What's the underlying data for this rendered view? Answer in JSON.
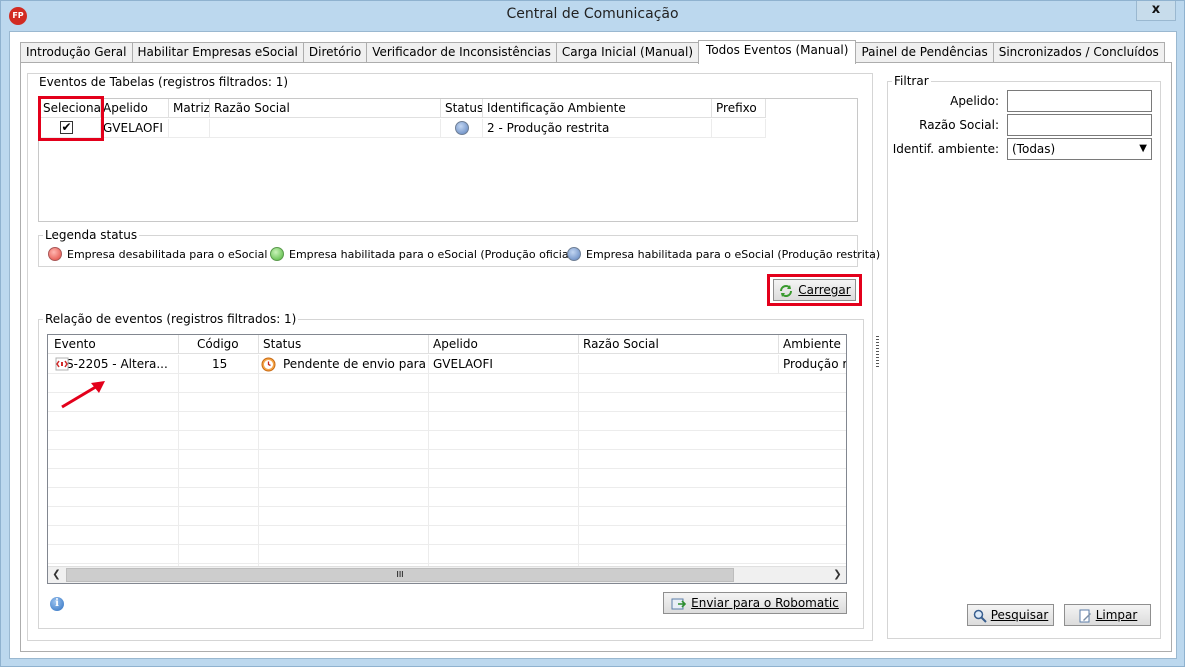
{
  "window": {
    "title": "Central de Comunicação",
    "app_icon_text": "FP",
    "close_glyph": "x"
  },
  "tabs": [
    {
      "label": "Introdução Geral",
      "active": false
    },
    {
      "label": "Habilitar Empresas eSocial",
      "active": false
    },
    {
      "label": "Diretório",
      "active": false
    },
    {
      "label": "Verificador de Inconsistências",
      "active": false
    },
    {
      "label": "Carga Inicial (Manual)",
      "active": false
    },
    {
      "label": "Todos Eventos (Manual)",
      "active": true
    },
    {
      "label": "Painel de Pendências",
      "active": false
    },
    {
      "label": "Sincronizados / Concluídos",
      "active": false
    }
  ],
  "eventos_tabelas": {
    "title": "Eventos de Tabelas (registros filtrados: 1)",
    "columns": [
      "Selecionar",
      "Apelido",
      "Matriz",
      "Razão Social",
      "Status",
      "Identificação Ambiente",
      "Prefixo"
    ],
    "rows": [
      {
        "selecionar": "✔",
        "apelido": "GVELAOFI",
        "matriz": "",
        "razao_social": "",
        "status": "blue",
        "identificacao_ambiente": "2 - Produção restrita",
        "prefixo": ""
      }
    ]
  },
  "legenda": {
    "title": "Legenda status",
    "items": [
      {
        "color": "red",
        "label": "Empresa desabilitada para o eSocial"
      },
      {
        "color": "green",
        "label": "Empresa habilitada para o eSocial (Produção oficial)"
      },
      {
        "color": "blue",
        "label": "Empresa habilitada para o eSocial (Produção restrita)"
      }
    ]
  },
  "buttons": {
    "carregar": "Carregar",
    "enviar": "Enviar para o Robomatic",
    "pesquisar": "Pesquisar",
    "limpar": "Limpar"
  },
  "relacao_eventos": {
    "title": "Relação de eventos (registros filtrados: 1)",
    "columns": [
      "Evento",
      "Código",
      "Status",
      "Apelido",
      "Razão Social",
      "Ambiente"
    ],
    "rows": [
      {
        "evento": "S-2205 - Altera...",
        "codigo": "15",
        "status": "Pendente de envio para ...",
        "apelido": "GVELAOFI",
        "razao_social": "",
        "ambiente": "Produção re"
      }
    ],
    "scroll_thumb_glyph": "III"
  },
  "filtrar": {
    "title": "Filtrar",
    "apelido_label": "Apelido:",
    "apelido_value": "",
    "razao_label": "Razão Social:",
    "razao_value": "",
    "ambiente_label": "Identif. ambiente:",
    "ambiente_value": "(Todas)"
  },
  "colors": {
    "highlight": "#e3001b",
    "window_chrome": "#bcd8ee"
  }
}
